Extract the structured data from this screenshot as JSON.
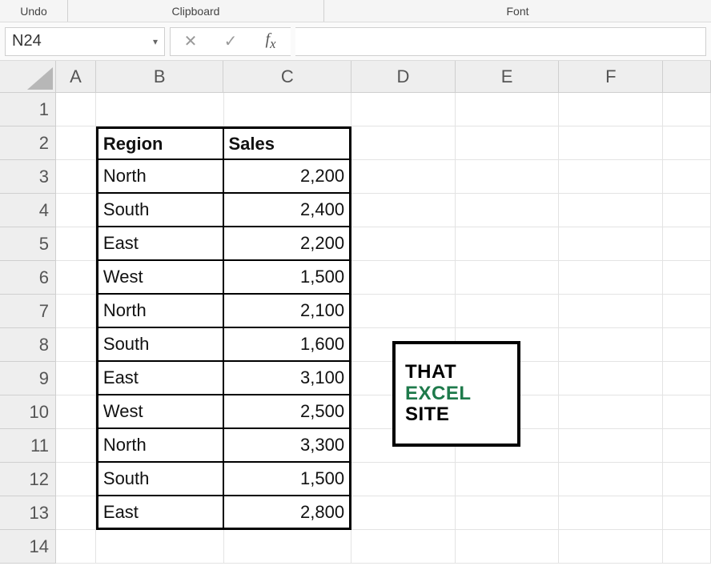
{
  "ribbon": {
    "undo": "Undo",
    "clipboard": "Clipboard",
    "font": "Font"
  },
  "nameBox": {
    "value": "N24"
  },
  "formulaBar": {
    "value": ""
  },
  "columns": [
    "A",
    "B",
    "C",
    "D",
    "E",
    "F"
  ],
  "rows": [
    "1",
    "2",
    "3",
    "4",
    "5",
    "6",
    "7",
    "8",
    "9",
    "10",
    "11",
    "12",
    "13",
    "14"
  ],
  "table": {
    "headers": {
      "region": "Region",
      "sales": "Sales"
    },
    "rows": [
      {
        "region": "North",
        "sales": "2,200"
      },
      {
        "region": "South",
        "sales": "2,400"
      },
      {
        "region": "East",
        "sales": "2,200"
      },
      {
        "region": "West",
        "sales": "1,500"
      },
      {
        "region": "North",
        "sales": "2,100"
      },
      {
        "region": "South",
        "sales": "1,600"
      },
      {
        "region": "East",
        "sales": "3,100"
      },
      {
        "region": "West",
        "sales": "2,500"
      },
      {
        "region": "North",
        "sales": "3,300"
      },
      {
        "region": "South",
        "sales": "1,500"
      },
      {
        "region": "East",
        "sales": "2,800"
      }
    ]
  },
  "logo": {
    "line1": "THAT",
    "line2": "EXCEL",
    "line3": "SITE"
  },
  "chart_data": {
    "type": "table",
    "title": "",
    "columns": [
      "Region",
      "Sales"
    ],
    "rows": [
      [
        "North",
        2200
      ],
      [
        "South",
        2400
      ],
      [
        "East",
        2200
      ],
      [
        "West",
        1500
      ],
      [
        "North",
        2100
      ],
      [
        "South",
        1600
      ],
      [
        "East",
        3100
      ],
      [
        "West",
        2500
      ],
      [
        "North",
        3300
      ],
      [
        "South",
        1500
      ],
      [
        "East",
        2800
      ]
    ]
  }
}
